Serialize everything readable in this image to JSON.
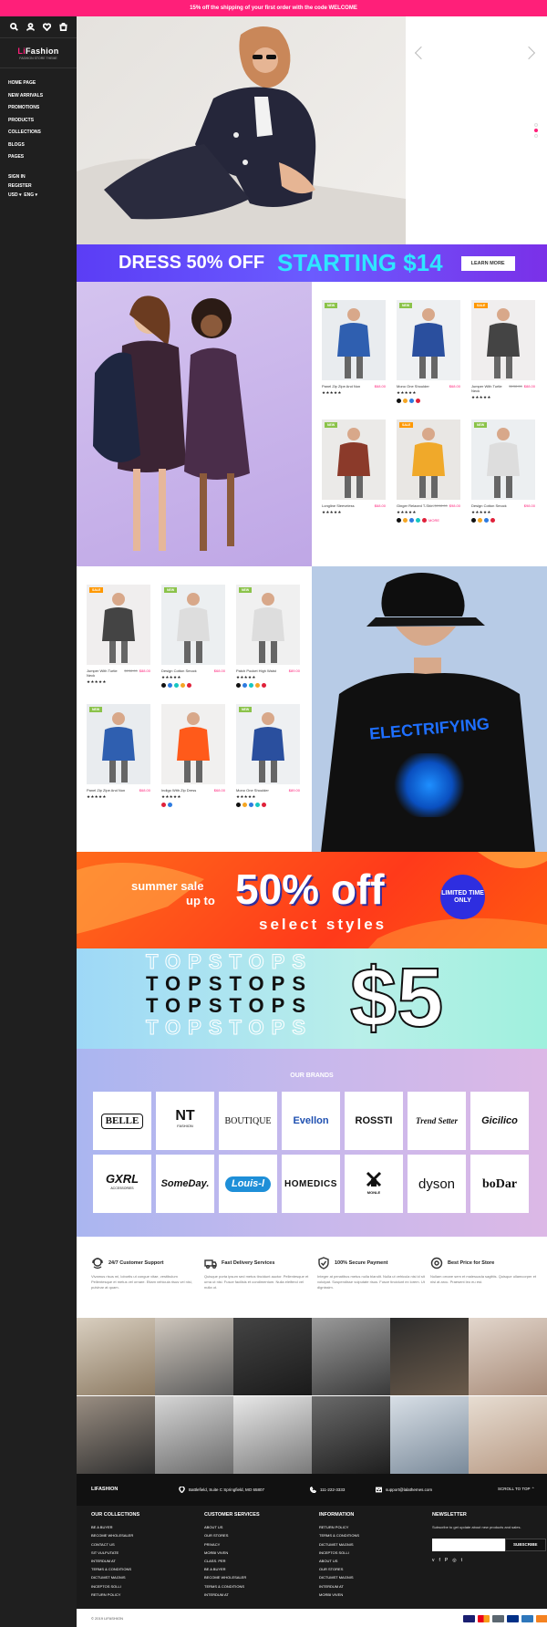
{
  "topbar": {
    "text": "15% off the shipping of your first order with the code WELCOME"
  },
  "brand": {
    "name_a": "Li",
    "name_b": "Fashion",
    "subtitle": "FASHION STORE THEME",
    "accent": "#ff1f79"
  },
  "sidebar": {
    "icons": [
      "search-icon",
      "user-icon",
      "heart-icon",
      "cart-icon"
    ],
    "counts": [
      "0",
      "0",
      "0"
    ],
    "nav": [
      "HOME PAGE",
      "NEW ARRIVALS",
      "PROMOTIONS",
      "PRODUCTS",
      "COLLECTIONS",
      "BLOGS",
      "PAGES"
    ],
    "account": [
      "SIGN IN",
      "REGISTER"
    ],
    "currency": "USD",
    "language": "ENG"
  },
  "banner1": {
    "text_a": "DRESS 50% OFF",
    "text_b": "STARTING $14",
    "button": "LEARN MORE"
  },
  "grid1": [
    {
      "name": "Panel Zip Zipe And Non",
      "price": "$68.00",
      "old": "",
      "badge": "NEW"
    },
    {
      "name": "Mono One Shoulder",
      "price": "$68.00",
      "old": "",
      "badge": "NEW"
    },
    {
      "name": "Jumper With Turtle Neck",
      "price": "$88.00",
      "old": "$138.00",
      "badge": "SALE"
    },
    {
      "name": "Longline Sleeveless",
      "price": "$68.00",
      "old": "",
      "badge": "NEW"
    },
    {
      "name": "Ginger Relaxed T-Shirt",
      "price": "$98.00",
      "old": "$108.00",
      "badge": "SALE"
    },
    {
      "name": "Design Cotton Smock",
      "price": "$98.00",
      "old": "",
      "badge": "NEW"
    }
  ],
  "grid2": [
    {
      "name": "Jumper With Turtle Neck",
      "price": "$88.00",
      "old": "$138.00",
      "badge": "SALE"
    },
    {
      "name": "Design Cotton Smock",
      "price": "$68.00",
      "old": "",
      "badge": "NEW"
    },
    {
      "name": "Patch Pocket High Waist",
      "price": "$89.00",
      "old": "",
      "badge": "NEW"
    },
    {
      "name": "Panel Zip Zipe And Non",
      "price": "$68.00",
      "old": "",
      "badge": "NEW"
    },
    {
      "name": "Indigo With Zip Dress",
      "price": "$68.00",
      "old": "",
      "badge": ""
    },
    {
      "name": "Mono One Shoulder",
      "price": "$89.00",
      "old": "",
      "badge": "NEW"
    }
  ],
  "more_label": "MORE",
  "tshirt": {
    "text": "ELECTRIFYING"
  },
  "sale": {
    "line1": "summer sale",
    "line2": "up to",
    "big": "50% off",
    "select": "select styles",
    "ltd": "LIMITED TIME ONLY"
  },
  "tops": {
    "word": "TOPSTOPS",
    "price": "$5"
  },
  "brands": {
    "title": "OUR BRANDS",
    "row1": [
      "BELLE",
      "NT",
      "BOUTIQUE",
      "Evellon",
      "ROSSTI",
      "Trend Setter",
      "Gicilico"
    ],
    "row2": [
      "GXRL",
      "SomeDay.",
      "Louis-l",
      "HOMEDICS",
      "MONLE",
      "dyson",
      "boDar"
    ],
    "nt_sub": "FASHION",
    "gxrl_sub": "ACCESSORIES"
  },
  "features": [
    {
      "title": "24/7 Customer Support",
      "text": "Vivamus risus mi, lobortis ut congue vitae, vestibulum Pellentesque et metus vel ornare. Etiam vehicula risus vel nisi, pulvinar at quam."
    },
    {
      "title": "Fast Delivery Services",
      "text": "Quisque porta ipsum sed metus tincidunt auctor. Pellentesque et urna ut nisi. Fusce facilisis et condimentum. Nulla eleifend vel nulla ut."
    },
    {
      "title": "100% Secure Payment",
      "text": "Integer at penatibus metus nulla blandit. Nulla ut vehicula nisi id sit volutpat. Suspendisse vulputate risus. Fusce tincidunt ex lorem. Ut dignissim."
    },
    {
      "title": "Best Price for Store",
      "text": "Nullam ornare sem et malesuada sagittis. Quisque ullamcorper et nisi at arcu. Praesent leo eu est."
    }
  ],
  "footer_bar": {
    "logo": "LIFASHION",
    "address": "Battlefield, Suite C Springfield, MO 65807",
    "phone": "111-222-3333",
    "email": "support@lalathemes.com",
    "scroll": "SCROLL TO TOP"
  },
  "footer": {
    "col1": {
      "title": "OUR COLLECTIONS",
      "items": [
        "BE A BUYER",
        "BECOME WHOLESALER",
        "CONTACT US",
        "SIT VULPUTATE",
        "INTERDUM AT",
        "TERMS & CONDITIONS",
        "DICTUMST MAGNIS",
        "INCEPTOS SOLLI",
        "RETURN POLICY"
      ]
    },
    "col2": {
      "title": "CUSTOMER SERVICES",
      "items": [
        "ABOUT US",
        "OUR STORES",
        "PRIVACY",
        "MORBI VIVEN",
        "CLASS. PER",
        "BE A BUYER",
        "BECOME WHOLESALER",
        "TERMS & CONDITIONS",
        "INTERDUM AT"
      ]
    },
    "col3": {
      "title": "INFORMATION",
      "items": [
        "RETURN POLICY",
        "TERMS & CONDITIONS",
        "DICTUMST MAGNIS",
        "INCEPTOS SOLLI",
        "ABOUT US",
        "OUR STORES",
        "DICTUMST MAGNIS",
        "INTERDUM AT",
        "MORBI VIVEN"
      ]
    },
    "news": {
      "title": "NEWSLETTER",
      "text": "Subscribe to get update about new products and sales.",
      "placeholder": "",
      "button": "SUBSCRIBE",
      "socials": [
        "v",
        "f",
        "P",
        "◎",
        "t"
      ]
    }
  },
  "copyright": "© 2019 LIFASHION"
}
